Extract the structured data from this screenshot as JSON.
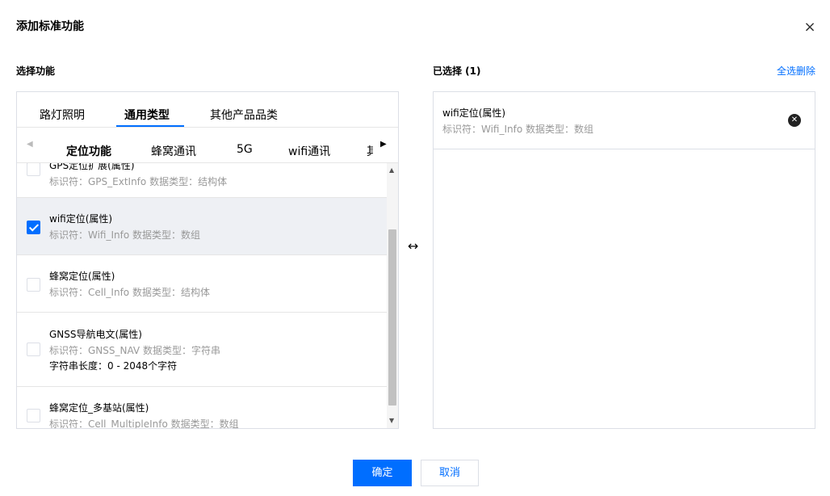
{
  "dialog": {
    "title": "添加标准功能",
    "close_icon": "×"
  },
  "left": {
    "section_label": "选择功能",
    "top_tabs": [
      {
        "label": "路灯照明"
      },
      {
        "label": "通用类型",
        "active": true
      },
      {
        "label": "其他产品品类"
      }
    ],
    "sub_tabs": [
      {
        "label": "定位功能",
        "active": true
      },
      {
        "label": "蜂窝通讯"
      },
      {
        "label": "5G"
      },
      {
        "label": "wifi通讯"
      },
      {
        "label": "其"
      }
    ],
    "items": [
      {
        "name": "GPS定位扩展(属性)",
        "meta": "标识符：GPS_ExtInfo 数据类型：结构体",
        "checked": false
      },
      {
        "name": "wifi定位(属性)",
        "meta": "标识符：Wifi_Info 数据类型：数组",
        "checked": true
      },
      {
        "name": "蜂窝定位(属性)",
        "meta": "标识符：Cell_Info 数据类型：结构体",
        "checked": false
      },
      {
        "name": "GNSS导航电文(属性)",
        "meta": "标识符：GNSS_NAV 数据类型：字符串",
        "extra": "字符串长度：0 - 2048个字符",
        "checked": false
      },
      {
        "name": "蜂窝定位_多基站(属性)",
        "meta": "标识符：Cell_MultipleInfo 数据类型：数组",
        "checked": false
      }
    ]
  },
  "right": {
    "section_label": "已选择 (1)",
    "select_all_delete": "全选删除",
    "items": [
      {
        "name": "wifi定位(属性)",
        "meta": "标识符：Wifi_Info 数据类型：数组"
      }
    ]
  },
  "footer": {
    "confirm": "确定",
    "cancel": "取消"
  },
  "colors": {
    "accent": "#006eff",
    "selected_row": "#eef0f4",
    "meta_text": "#999999",
    "border": "#dcdfe6"
  }
}
